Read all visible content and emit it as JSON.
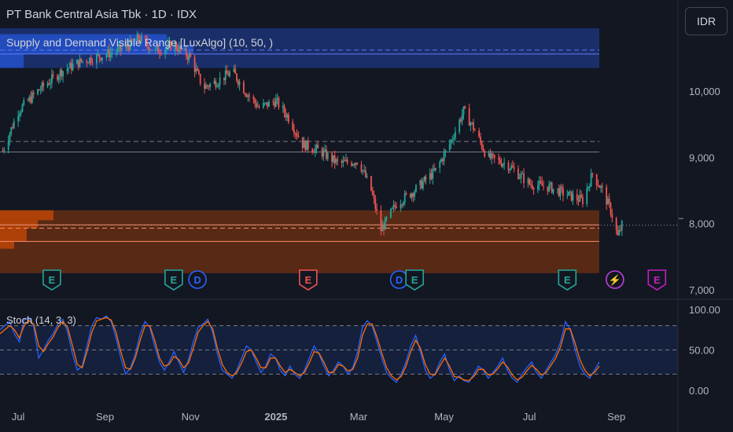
{
  "header": {
    "title": "PT Bank Central Asia Tbk · 1D · IDX",
    "currency": "IDR"
  },
  "indicators": {
    "main": "Supply and Demand Visible Range [LuxAlgo] (10, 50, )",
    "stoch": "Stoch (14, 3, 3)"
  },
  "colors": {
    "background": "#131722",
    "up": "#26a69a",
    "down": "#ef5350",
    "supply_zone": "#2962ff",
    "demand_zone": "#e65100",
    "stoch_k": "#2962ff",
    "stoch_d": "#ff6d00"
  },
  "event_markers": [
    {
      "type": "E",
      "date": "2024-07-25",
      "color": "#26a69a"
    },
    {
      "type": "E",
      "date": "2024-10-20",
      "color": "#26a69a"
    },
    {
      "type": "D",
      "date": "2024-11-06",
      "color": "#2962ff"
    },
    {
      "type": "E",
      "date": "2025-01-24",
      "color": "#ef5350"
    },
    {
      "type": "D",
      "date": "2025-03-30",
      "color": "#2962ff"
    },
    {
      "type": "E",
      "date": "2025-04-10",
      "color": "#26a69a"
    },
    {
      "type": "E",
      "date": "2025-07-28",
      "color": "#26a69a"
    },
    {
      "type": "⚡",
      "date": "2025-08-31",
      "color": "#c040e0"
    },
    {
      "type": "E",
      "date": "2025-09-30",
      "color": "#c020c0"
    }
  ],
  "chart_data": [
    {
      "type": "candlestick",
      "title": "PT Bank Central Asia Tbk · 1D · IDX",
      "y_ticks": [
        "10,000",
        "9,000",
        "8,000",
        "7,000"
      ],
      "x_ticks": [
        "Jul",
        "Sep",
        "Nov",
        "2025",
        "Mar",
        "May",
        "Jul",
        "Sep"
      ],
      "ylim": [
        6950,
        10950
      ],
      "xlim": [
        "2024-06-18",
        "2025-10-15"
      ],
      "price_path": [
        {
          "date": "2024-06-20",
          "close": 9100
        },
        {
          "date": "2024-07-01",
          "close": 9700
        },
        {
          "date": "2024-07-15",
          "close": 10000
        },
        {
          "date": "2024-08-01",
          "close": 10300
        },
        {
          "date": "2024-08-15",
          "close": 10450
        },
        {
          "date": "2024-09-01",
          "close": 10550
        },
        {
          "date": "2024-09-15",
          "close": 10650
        },
        {
          "date": "2024-09-25",
          "close": 10800
        },
        {
          "date": "2024-10-07",
          "close": 10600
        },
        {
          "date": "2024-10-20",
          "close": 10700
        },
        {
          "date": "2024-11-01",
          "close": 10500
        },
        {
          "date": "2024-11-10",
          "close": 10050
        },
        {
          "date": "2024-11-20",
          "close": 10150
        },
        {
          "date": "2024-12-01",
          "close": 10300
        },
        {
          "date": "2024-12-10",
          "close": 10000
        },
        {
          "date": "2024-12-20",
          "close": 9750
        },
        {
          "date": "2025-01-01",
          "close": 9850
        },
        {
          "date": "2025-01-10",
          "close": 9600
        },
        {
          "date": "2025-01-20",
          "close": 9200
        },
        {
          "date": "2025-02-01",
          "close": 9100
        },
        {
          "date": "2025-02-15",
          "close": 8900
        },
        {
          "date": "2025-03-01",
          "close": 8950
        },
        {
          "date": "2025-03-10",
          "close": 8500
        },
        {
          "date": "2025-03-17",
          "close": 7900
        },
        {
          "date": "2025-03-28",
          "close": 8300
        },
        {
          "date": "2025-04-10",
          "close": 8500
        },
        {
          "date": "2025-04-25",
          "close": 8800
        },
        {
          "date": "2025-05-05",
          "close": 9200
        },
        {
          "date": "2025-05-15",
          "close": 9700
        },
        {
          "date": "2025-05-22",
          "close": 9450
        },
        {
          "date": "2025-06-01",
          "close": 9000
        },
        {
          "date": "2025-06-15",
          "close": 8900
        },
        {
          "date": "2025-07-01",
          "close": 8600
        },
        {
          "date": "2025-07-15",
          "close": 8550
        },
        {
          "date": "2025-08-01",
          "close": 8400
        },
        {
          "date": "2025-08-08",
          "close": 8350
        },
        {
          "date": "2025-08-15",
          "close": 8750
        },
        {
          "date": "2025-08-22",
          "close": 8500
        },
        {
          "date": "2025-08-28",
          "close": 8200
        },
        {
          "date": "2025-09-02",
          "close": 7800
        },
        {
          "date": "2025-09-05",
          "close": 7975
        }
      ],
      "last_price": 7975,
      "zones": [
        {
          "name": "supply",
          "from": 10350,
          "to": 10950
        },
        {
          "name": "demand",
          "from": 7250,
          "to": 8200
        }
      ],
      "levels": [
        {
          "value": 10560,
          "style": "solid"
        },
        {
          "value": 10620,
          "style": "dashed"
        },
        {
          "value": 9240,
          "style": "dashed"
        },
        {
          "value": 9080,
          "style": "solid"
        },
        {
          "value": 7930,
          "style": "dashed"
        },
        {
          "value": 7980,
          "style": "solid"
        },
        {
          "value": 7730,
          "style": "solid"
        }
      ]
    },
    {
      "type": "line",
      "title": "Stoch (14, 3, 3)",
      "y_ticks": [
        "100.00",
        "50.00",
        "0.00"
      ],
      "ylim": [
        0,
        100
      ],
      "bands": [
        20,
        50,
        80
      ],
      "series": [
        {
          "name": "",
          "values": [
            75,
            80,
            85,
            70,
            60,
            88,
            90,
            78,
            40,
            50,
            62,
            70,
            82,
            88,
            72,
            45,
            25,
            30,
            55,
            80,
            90,
            88,
            92,
            85,
            65,
            40,
            20,
            28,
            45,
            70,
            85,
            78,
            55,
            35,
            25,
            35,
            48,
            35,
            22,
            38,
            60,
            78,
            82,
            88,
            72,
            45,
            25,
            20,
            15,
            25,
            40,
            55,
            50,
            35,
            22,
            30,
            45,
            40,
            25,
            18,
            30,
            20,
            15,
            25,
            40,
            55,
            45,
            30,
            18,
            25,
            35,
            30,
            20,
            28,
            48,
            78,
            86,
            80,
            60,
            40,
            22,
            15,
            10,
            20,
            35,
            55,
            68,
            48,
            25,
            15,
            20,
            35,
            45,
            25,
            12,
            18,
            12,
            10,
            20,
            30,
            25,
            15,
            22,
            30,
            40,
            25,
            15,
            10,
            20,
            28,
            35,
            22,
            15,
            25,
            35,
            45,
            60,
            85,
            75,
            50,
            30,
            20,
            15,
            25,
            35
          ]
        },
        {
          "name": "",
          "values": [
            70,
            75,
            80,
            75,
            65,
            80,
            86,
            82,
            55,
            48,
            58,
            66,
            78,
            85,
            78,
            55,
            32,
            28,
            48,
            72,
            86,
            88,
            90,
            87,
            72,
            48,
            28,
            26,
            40,
            62,
            80,
            80,
            62,
            40,
            30,
            32,
            42,
            38,
            28,
            34,
            52,
            72,
            80,
            85,
            76,
            52,
            32,
            22,
            18,
            22,
            34,
            48,
            50,
            40,
            28,
            28,
            40,
            40,
            30,
            22,
            26,
            22,
            18,
            22,
            34,
            48,
            46,
            35,
            22,
            22,
            32,
            30,
            24,
            26,
            40,
            68,
            82,
            82,
            66,
            46,
            28,
            18,
            13,
            17,
            30,
            48,
            62,
            52,
            32,
            20,
            19,
            30,
            40,
            30,
            17,
            16,
            13,
            12,
            17,
            26,
            26,
            19,
            20,
            27,
            35,
            29,
            19,
            13,
            16,
            24,
            31,
            26,
            19,
            22,
            31,
            40,
            54,
            76,
            76,
            58,
            38,
            25,
            18,
            22,
            30
          ]
        }
      ]
    }
  ]
}
